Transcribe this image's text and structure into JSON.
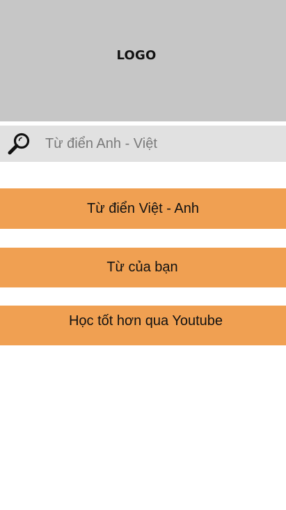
{
  "header": {
    "logo_text": "LOGO"
  },
  "search": {
    "placeholder": "Từ điển Anh - Việt",
    "value": "",
    "icon": "search-icon"
  },
  "menu": {
    "items": [
      {
        "label": "Từ điển Việt - Anh"
      },
      {
        "label": "Từ của bạn"
      },
      {
        "label": "Học tốt hơn qua Youtube"
      }
    ]
  },
  "colors": {
    "logo_background": "#c6c6c6",
    "search_background": "#e1e1e1",
    "button_accent": "#f0a052",
    "page_background": "#ffffff"
  }
}
